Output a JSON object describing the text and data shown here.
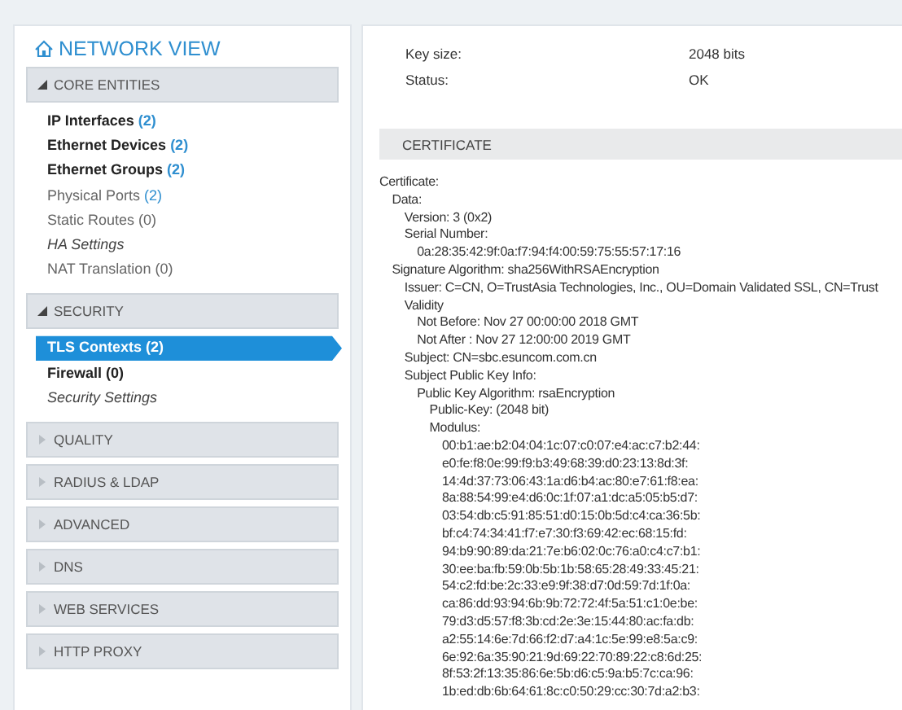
{
  "sidebar": {
    "title": "NETWORK VIEW",
    "sections": [
      {
        "title": "CORE ENTITIES",
        "expanded": true,
        "items": [
          {
            "label": "IP Interfaces",
            "count": "(2)",
            "kind": "strong",
            "count_highlighted": true,
            "selected": false
          },
          {
            "label": "Ethernet Devices",
            "count": "(2)",
            "kind": "strong",
            "count_highlighted": true,
            "selected": false
          },
          {
            "label": "Ethernet Groups",
            "count": "(2)",
            "kind": "strong",
            "count_highlighted": true,
            "selected": false
          },
          {
            "label": "Physical Ports",
            "count": "(2)",
            "kind": "muted",
            "count_highlighted": true,
            "selected": false
          },
          {
            "label": "Static Routes",
            "count": "(0)",
            "kind": "muted",
            "count_highlighted": false,
            "selected": false
          },
          {
            "label": "HA Settings",
            "kind": "setting",
            "selected": false
          },
          {
            "label": "NAT Translation",
            "count": "(0)",
            "kind": "muted",
            "count_highlighted": false,
            "selected": false
          }
        ]
      },
      {
        "title": "SECURITY",
        "expanded": true,
        "items": [
          {
            "label": "TLS Contexts",
            "count": "(2)",
            "kind": "strong",
            "count_highlighted": false,
            "selected": true
          },
          {
            "label": "Firewall",
            "count": "(0)",
            "kind": "strong",
            "count_highlighted": false,
            "selected": false
          },
          {
            "label": "Security Settings",
            "kind": "setting",
            "selected": false
          }
        ]
      },
      {
        "title": "QUALITY",
        "expanded": false
      },
      {
        "title": "RADIUS & LDAP",
        "expanded": false
      },
      {
        "title": "ADVANCED",
        "expanded": false
      },
      {
        "title": "DNS",
        "expanded": false
      },
      {
        "title": "WEB SERVICES",
        "expanded": false
      },
      {
        "title": "HTTP PROXY",
        "expanded": false
      }
    ]
  },
  "details": {
    "fields": [
      {
        "label": "Key size:",
        "value": "2048  bits"
      },
      {
        "label": "Status:",
        "value": "OK"
      }
    ]
  },
  "certificate": {
    "title": "CERTIFICATE",
    "lines": [
      {
        "text": "Certificate:",
        "children": [
          {
            "text": "Data:",
            "children": [
              {
                "text": "Version: 3 (0x2)"
              },
              {
                "text": "Serial Number:",
                "children": [
                  {
                    "text": "0a:28:35:42:9f:0a:f7:94:f4:00:59:75:55:57:17:16"
                  }
                ]
              }
            ]
          },
          {
            "text": "Signature Algorithm: sha256WithRSAEncryption",
            "children": [
              {
                "text": "Issuer: C=CN, O=TrustAsia Technologies, Inc., OU=Domain Validated SSL, CN=Trust"
              },
              {
                "text": "Validity",
                "children": [
                  {
                    "text": "Not Before: Nov 27 00:00:00 2018 GMT"
                  },
                  {
                    "text": "Not After : Nov 27 12:00:00 2019 GMT"
                  }
                ]
              },
              {
                "text": "Subject: CN=sbc.esuncom.com.cn"
              },
              {
                "text": "Subject Public Key Info:",
                "children": [
                  {
                    "text": "Public Key Algorithm: rsaEncryption",
                    "children": [
                      {
                        "text": "Public-Key: (2048 bit)"
                      },
                      {
                        "text": "Modulus:",
                        "children": [
                          {
                            "text": "00:b1:ae:b2:04:04:1c:07:c0:07:e4:ac:c7:b2:44:"
                          },
                          {
                            "text": "e0:fe:f8:0e:99:f9:b3:49:68:39:d0:23:13:8d:3f:"
                          },
                          {
                            "text": "14:4d:37:73:06:43:1a:d6:b4:ac:80:e7:61:f8:ea:"
                          },
                          {
                            "text": "8a:88:54:99:e4:d6:0c:1f:07:a1:dc:a5:05:b5:d7:"
                          },
                          {
                            "text": "03:54:db:c5:91:85:51:d0:15:0b:5d:c4:ca:36:5b:"
                          },
                          {
                            "text": "bf:c4:74:34:41:f7:e7:30:f3:69:42:ec:68:15:fd:"
                          },
                          {
                            "text": "94:b9:90:89:da:21:7e:b6:02:0c:76:a0:c4:c7:b1:"
                          },
                          {
                            "text": "30:ee:ba:fb:59:0b:5b:1b:58:65:28:49:33:45:21:"
                          },
                          {
                            "text": "54:c2:fd:be:2c:33:e9:9f:38:d7:0d:59:7d:1f:0a:"
                          },
                          {
                            "text": "ca:86:dd:93:94:6b:9b:72:72:4f:5a:51:c1:0e:be:"
                          },
                          {
                            "text": "79:d3:d5:57:f8:3b:cd:2e:3e:15:44:80:ac:fa:db:"
                          },
                          {
                            "text": "a2:55:14:6e:7d:66:f2:d7:a4:1c:5e:99:e8:5a:c9:"
                          },
                          {
                            "text": "6e:92:6a:35:90:21:9d:69:22:70:89:22:c8:6d:25:"
                          },
                          {
                            "text": "8f:53:2f:13:35:86:6e:5b:d6:c5:9a:b5:7c:ca:96:"
                          },
                          {
                            "text": "1b:ed:db:6b:64:61:8c:c0:50:29:cc:30:7d:a2:b3:"
                          }
                        ]
                      }
                    ]
                  }
                ]
              }
            ]
          }
        ]
      }
    ]
  }
}
